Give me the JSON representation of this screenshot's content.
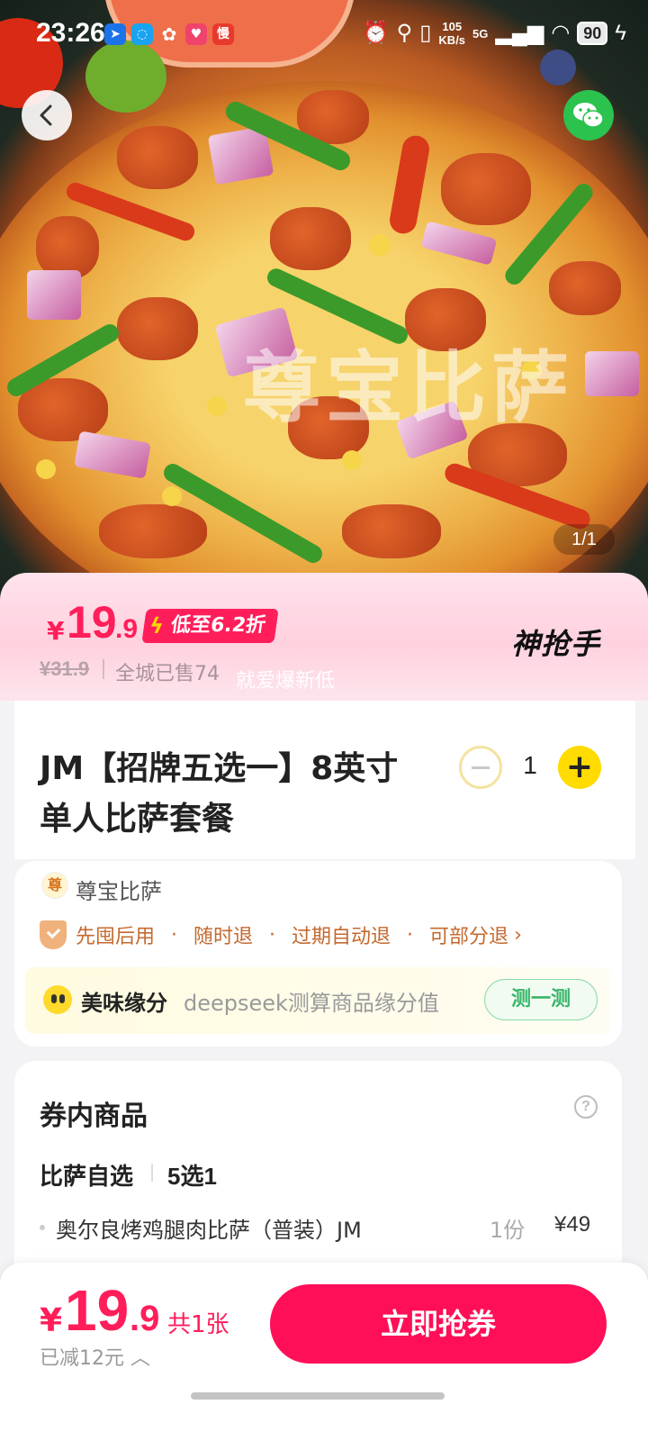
{
  "status_bar": {
    "time": "23:26",
    "net_speed_value": "105",
    "net_speed_unit": "KB/s",
    "signal": "5G",
    "battery": "90",
    "app_icon_label": "慢"
  },
  "hero": {
    "watermark": "尊宝比萨",
    "page_indicator": "1/1"
  },
  "price_banner": {
    "currency": "¥",
    "price_int": "19",
    "price_dec": ".9",
    "discount": "低至6.2折",
    "brand": "神抢手",
    "original_price": "¥31.9",
    "sold": "全城已售74",
    "slogan": "就爱爆新低"
  },
  "product": {
    "title": "JM【招牌五选一】8英寸单人比萨套餐",
    "quantity": "1"
  },
  "store": {
    "name": "尊宝比萨",
    "logo_text": "尊",
    "guarantees": [
      "先囤后用",
      "随时退",
      "过期自动退",
      "可部分退"
    ]
  },
  "match": {
    "title": "美味缘分",
    "desc": "deepseek测算商品缘分值",
    "button": "测一测"
  },
  "coupon_items": {
    "title": "券内商品",
    "help": "?",
    "group_name": "比萨自选",
    "group_rule": "5选1",
    "items": [
      {
        "name": "奥尔良烤鸡腿肉比萨（普装）JM",
        "qty": "1份",
        "price": "¥49"
      }
    ]
  },
  "bottom_bar": {
    "currency": "¥",
    "price_int": "19",
    "price_dec": ".9",
    "count": "共1张",
    "saved": "已减12元",
    "buy_button": "立即抢券"
  },
  "colors": {
    "accent": "#ff1e5a",
    "button": "#ff0f57",
    "plus": "#ffdb00",
    "wechat": "#2bc24e"
  }
}
